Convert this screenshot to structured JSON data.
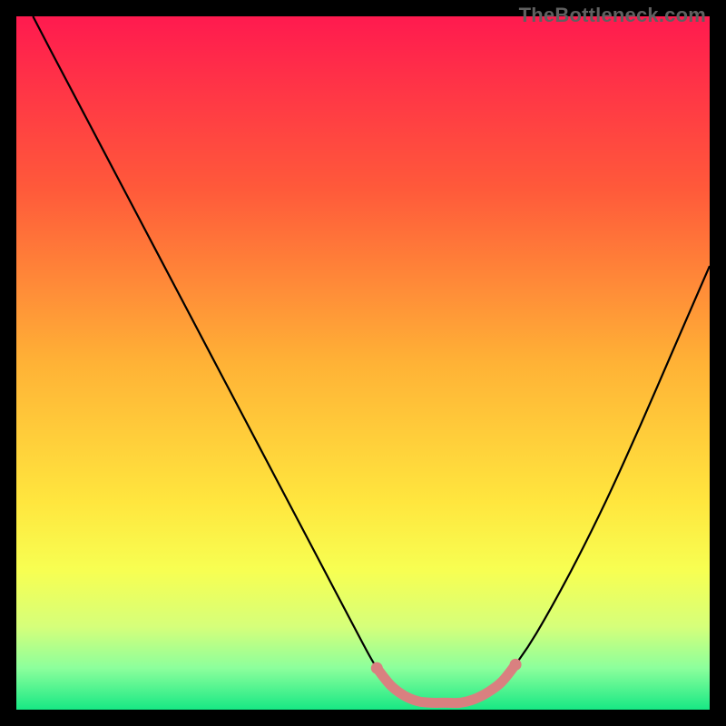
{
  "watermark": "TheBottleneck.com",
  "chart_data": {
    "type": "line",
    "title": "",
    "xlabel": "",
    "ylabel": "",
    "xlim": [
      0,
      100
    ],
    "ylim": [
      0,
      100
    ],
    "grid": false,
    "legend": false,
    "background_gradient_stops": [
      {
        "offset": 0.0,
        "color": "#ff1a4f"
      },
      {
        "offset": 0.25,
        "color": "#ff5a3a"
      },
      {
        "offset": 0.5,
        "color": "#ffb236"
      },
      {
        "offset": 0.7,
        "color": "#ffe63e"
      },
      {
        "offset": 0.8,
        "color": "#f7ff52"
      },
      {
        "offset": 0.88,
        "color": "#d6ff7a"
      },
      {
        "offset": 0.94,
        "color": "#8cff9c"
      },
      {
        "offset": 1.0,
        "color": "#17e884"
      }
    ],
    "series": [
      {
        "name": "bottleneck-curve",
        "stroke": "#000000",
        "stroke_width": 2.2,
        "x": [
          2.4,
          5,
          10,
          15,
          20,
          25,
          30,
          35,
          40,
          45,
          50,
          52,
          54,
          56,
          58,
          60,
          62,
          64,
          66,
          68,
          70,
          72,
          75,
          80,
          85,
          90,
          95,
          100
        ],
        "y": [
          100,
          95,
          85.5,
          76,
          66.5,
          57,
          47.5,
          38,
          28.5,
          19,
          9.5,
          6,
          3.5,
          2,
          1.2,
          1,
          1,
          1,
          1.5,
          2.5,
          4,
          6.5,
          11,
          20,
          30,
          41,
          52.5,
          64
        ]
      }
    ],
    "highlight_band": {
      "name": "optimal-range",
      "color": "#d98080",
      "stroke_width": 11,
      "endpoint_radius": 6.5,
      "x": [
        52,
        54,
        56,
        58,
        60,
        62,
        64,
        66,
        68,
        70,
        72
      ],
      "y": [
        6,
        3.5,
        2,
        1.2,
        1,
        1,
        1,
        1.5,
        2.5,
        4,
        6.5
      ]
    }
  }
}
